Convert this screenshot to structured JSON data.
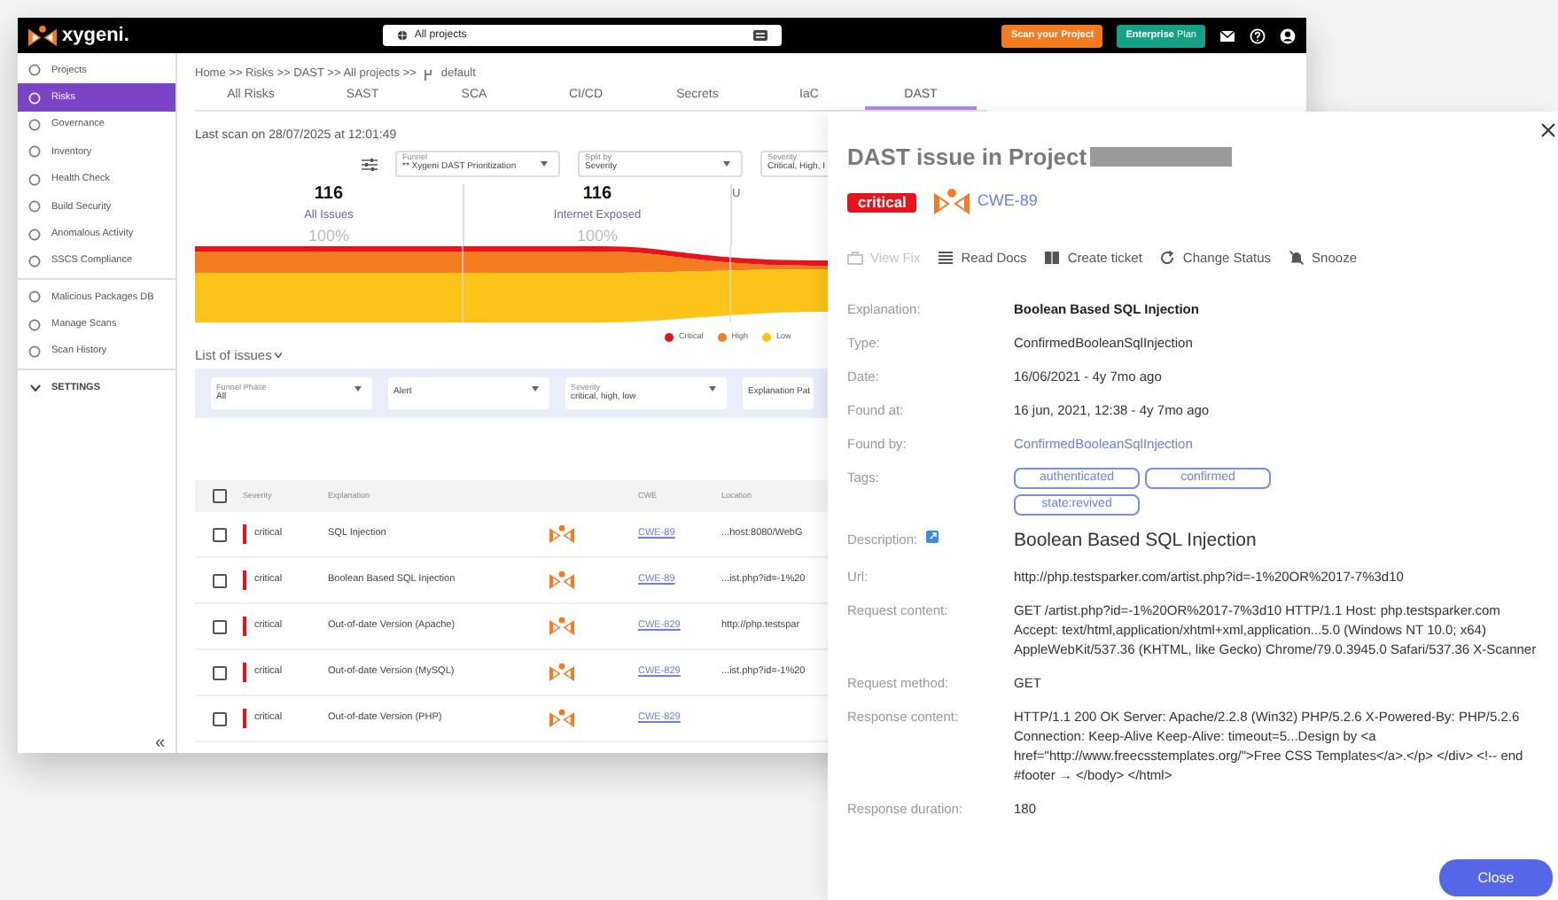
{
  "header": {
    "logo": "xygeni.",
    "project_selector": "All projects",
    "buttons": [
      {
        "label": "Scan your Project",
        "kind": "scan"
      },
      {
        "label": "**Enterprise** Plan",
        "kind": "plan"
      }
    ]
  },
  "sidebar": {
    "groups": [
      [
        {
          "label": "Projects",
          "selected": false
        },
        {
          "label": "Risks",
          "selected": true
        },
        {
          "label": "Governance",
          "selected": false
        },
        {
          "label": "Inventory",
          "selected": false
        },
        {
          "label": "Health Check",
          "selected": false
        },
        {
          "label": "Build Security",
          "selected": false
        },
        {
          "label": "Anomalous Activity",
          "selected": false
        },
        {
          "label": "SSCS Compliance",
          "selected": false
        }
      ],
      [
        {
          "label": "Malicious Packages DB",
          "selected": false
        },
        {
          "label": "Manage Scans",
          "selected": false
        },
        {
          "label": "Scan History",
          "selected": false
        }
      ]
    ],
    "section": {
      "label": "SETTINGS",
      "expanded": false
    },
    "collapse": "«"
  },
  "breadcrumb": {
    "path": "Home >> Risks >> DAST >> All projects >>",
    "branch": "default"
  },
  "tabs": [
    {
      "label": "All Risks",
      "selected": false
    },
    {
      "label": "SAST",
      "selected": false
    },
    {
      "label": "SCA",
      "selected": false
    },
    {
      "label": "CI/CD",
      "selected": false
    },
    {
      "label": "Secrets",
      "selected": false
    },
    {
      "label": "IaC",
      "selected": false
    },
    {
      "label": "DAST",
      "selected": true
    }
  ],
  "last_scan": "Last scan on 28/07/2025 at 12:01:49",
  "selects": [
    {
      "label": "Funnel",
      "value": "** Xygeni DAST Prioritization"
    },
    {
      "label": "Split by",
      "value": "Severity"
    },
    {
      "label": "Severity",
      "value": "Critical, High, I"
    }
  ],
  "stats": [
    {
      "count": "116",
      "label": "All Issues",
      "percent": "100%"
    },
    {
      "count": "116",
      "label": "Internet Exposed",
      "percent": "100%"
    },
    {
      "label": "U"
    }
  ],
  "legend": [
    {
      "label": "Critical",
      "color": "#e8141c"
    },
    {
      "label": "High",
      "color": "#f47b20"
    },
    {
      "label": "Low",
      "color": "#fcc419"
    }
  ],
  "list_title": "List of issues",
  "filters": [
    {
      "label": "Funnel Phase",
      "value": "All"
    },
    {
      "value": "Alert"
    },
    {
      "label": "Severity",
      "value": "critical, high, low"
    },
    {
      "value": "Explanation Pat"
    }
  ],
  "table": {
    "columns": [
      "Severity",
      "Explanation",
      "CWE",
      "Location"
    ],
    "header_checked": false,
    "rows": [
      {
        "checked": false,
        "severity": "critical",
        "explanation": "SQL Injection",
        "cwe": "CWE-89",
        "location": "...host:8080/WebG"
      },
      {
        "checked": false,
        "severity": "critical",
        "explanation": "Boolean Based SQL Injection",
        "cwe": "CWE-89",
        "location": "...ist.php?id=-1%20"
      },
      {
        "checked": false,
        "severity": "critical",
        "explanation": "Out-of-date Version (Apache)",
        "cwe": "CWE-829",
        "location": "http://php.testspar"
      },
      {
        "checked": false,
        "severity": "critical",
        "explanation": "Out-of-date Version (MySQL)",
        "cwe": "CWE-829",
        "location": "...ist.php?id=-1%20"
      },
      {
        "checked": false,
        "severity": "critical",
        "explanation": "Out-of-date Version (PHP)",
        "cwe": "CWE-829"
      }
    ]
  },
  "panel": {
    "title": "DAST issue in Project",
    "severity": "critical",
    "cwe": "CWE-89",
    "actions": [
      {
        "label": "View Fix",
        "kind": "fix",
        "disabled": true
      },
      {
        "label": "Read Docs",
        "kind": "docs",
        "disabled": false
      },
      {
        "label": "Create ticket",
        "kind": "ticket",
        "disabled": false
      },
      {
        "label": "Change Status",
        "kind": "status",
        "disabled": false
      },
      {
        "label": "Snooze",
        "kind": "snooze",
        "disabled": false
      }
    ],
    "fields": [
      {
        "label": "Explanation:",
        "kind": "strong",
        "value": "Boolean Based SQL Injection"
      },
      {
        "label": "Type:",
        "kind": "text",
        "value": "ConfirmedBooleanSqlInjection"
      },
      {
        "label": "Date:",
        "kind": "text",
        "value": "16/06/2021 - 4y 7mo ago"
      },
      {
        "label": "Found at:",
        "kind": "text",
        "value": "16 jun, 2021, 12:38 - 4y 7mo ago"
      },
      {
        "label": "Found by:",
        "kind": "link",
        "value": "ConfirmedBooleanSqlInjection"
      },
      {
        "label": "Tags:",
        "kind": "tags",
        "tags": [
          "authenticated",
          "confirmed",
          "state:revived"
        ]
      },
      {
        "label": "Description:",
        "kind": "heading",
        "value": "Boolean Based SQL Injection"
      },
      {
        "label": "Url:",
        "kind": "text",
        "value": "http://php.testsparker.com/artist.php?id=-1%20OR%2017-7%3d10"
      },
      {
        "label": "Request content:",
        "kind": "text",
        "value": "GET /artist.php?id=-1%20OR%2017-7%3d10 HTTP/1.1 Host: php.testsparker.com Accept: text/html,application/xhtml+xml,application...5.0 (Windows NT 10.0; x64) AppleWebKit/537.36 (KHTML, like Gecko) Chrome/79.0.3945.0 Safari/537.36 X-Scanner"
      },
      {
        "label": "Request method:",
        "kind": "text",
        "value": "GET"
      },
      {
        "label": "Response content:",
        "kind": "text",
        "value": "HTTP/1.1 200 OK Server: Apache/2.2.8 (Win32) PHP/5.2.6 X-Powered-By: PHP/5.2.6 Connection: Keep-Alive Keep-Alive: timeout=5...Design by <a href=\"http://www.freecsstemplates.org/\">Free CSS Templates</a>.</p> </div> <!-- end #footer → </body> </html>"
      },
      {
        "label": "Response duration:",
        "kind": "text",
        "value": "180"
      }
    ],
    "close": "Close"
  }
}
